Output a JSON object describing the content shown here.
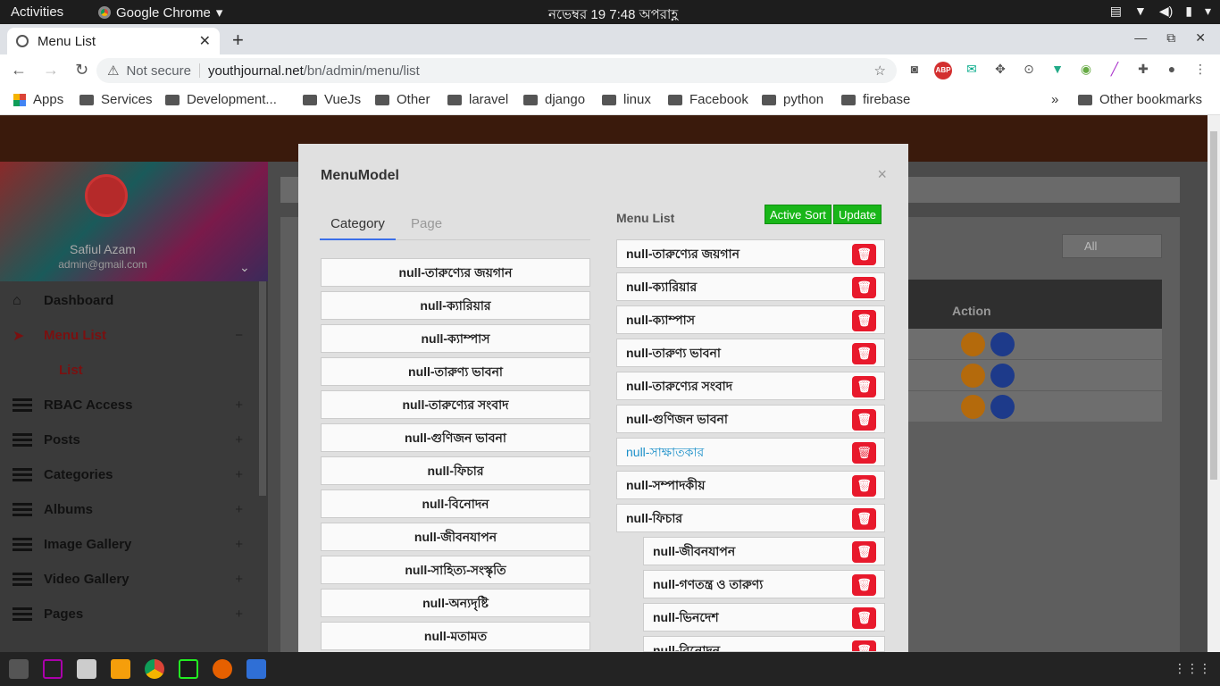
{
  "topbar": {
    "activities": "Activities",
    "app": "Google Chrome",
    "clock": "নভেম্বর 19   7:48 অপরাহ্ণ"
  },
  "browser": {
    "tab_title": "Menu List",
    "not_secure": "Not secure",
    "url_host": "youthjournal.net",
    "url_path": "/bn/admin/menu/list",
    "bookmarks": [
      "Apps",
      "Services",
      "Development...",
      "VueJs",
      "Other",
      "laravel",
      "django",
      "linux",
      "Facebook",
      "python",
      "firebase"
    ],
    "more": "»",
    "other_bookmarks": "Other bookmarks"
  },
  "sidebar": {
    "user_name": "Safiul Azam",
    "user_email": "admin@gmail.com",
    "items": [
      {
        "label": "Dashboard",
        "sign": ""
      },
      {
        "label": "Menu List",
        "sign": "−"
      },
      {
        "label": "List",
        "sign": ""
      },
      {
        "label": "RBAC Access",
        "sign": "+"
      },
      {
        "label": "Posts",
        "sign": "+"
      },
      {
        "label": "Categories",
        "sign": "+"
      },
      {
        "label": "Albums",
        "sign": "+"
      },
      {
        "label": "Image Gallery",
        "sign": "+"
      },
      {
        "label": "Video Gallery",
        "sign": "+"
      },
      {
        "label": "Pages",
        "sign": "+"
      }
    ]
  },
  "main": {
    "filter_value": "All",
    "table_action_header": "Action"
  },
  "modal": {
    "title": "MenuModel",
    "close": "×",
    "tabs": [
      "Category",
      "Page"
    ],
    "categories": [
      "null-তারুণ্যের জয়গান",
      "null-ক্যারিয়ার",
      "null-ক্যাম্পাস",
      "null-তারুণ্য ভাবনা",
      "null-তারুণ্যের সংবাদ",
      "null-গুণিজন ভাবনা",
      "null-ফিচার",
      "null-বিনোদন",
      "null-জীবনযাপন",
      "null-সাহিত্য-সংস্কৃতি",
      "null-অন্যদৃষ্টি",
      "null-মতামত"
    ],
    "menu_list_title": "Menu List",
    "active_sort": "Active Sort",
    "update": "Update",
    "menu_items": [
      "null-তারুণ্যের জয়গান",
      "null-ক্যারিয়ার",
      "null-ক্যাম্পাস",
      "null-তারুণ্য ভাবনা",
      "null-তারুণ্যের সংবাদ",
      "null-গুণিজন ভাবনা",
      "null-সাক্ষাতকার",
      "null-সম্পাদকীয়",
      "null-ফিচার"
    ],
    "sub_items": [
      "null-জীবনযাপন",
      "null-গণতন্ত্র ও তারুণ্য",
      "null-ভিনদেশ",
      "null-বিনোদন"
    ]
  }
}
